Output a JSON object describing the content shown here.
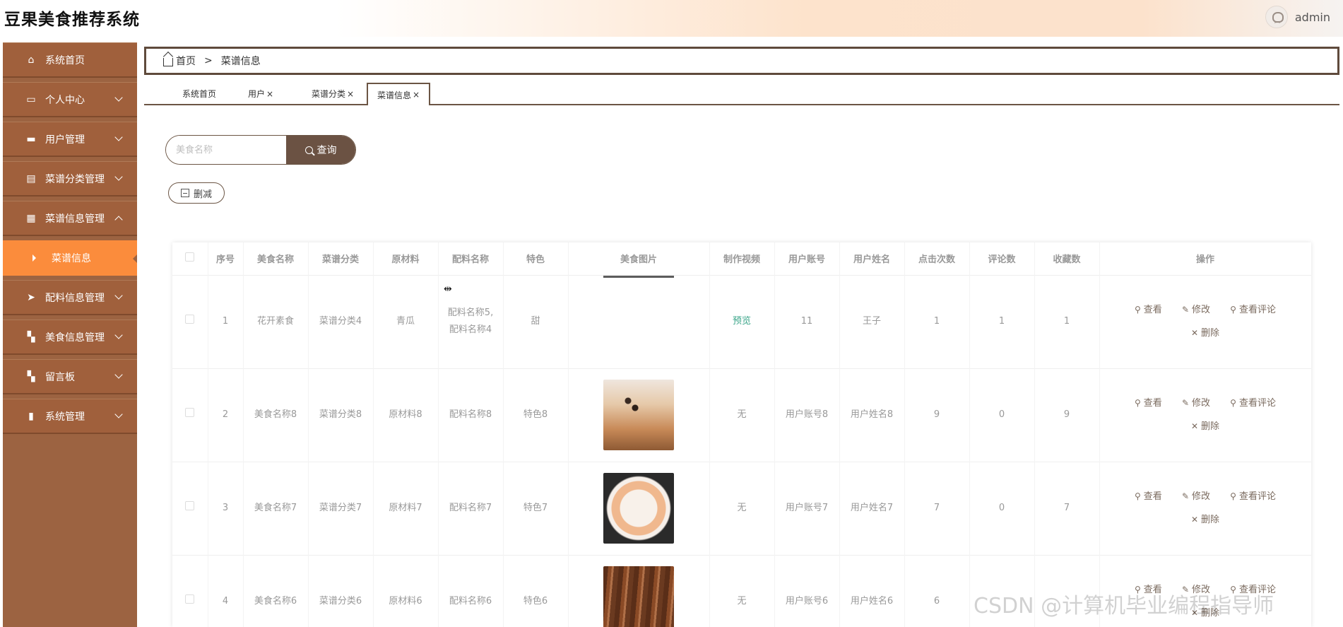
{
  "app": {
    "title": "豆果美食推荐系统",
    "user": "admin"
  },
  "sidebar": {
    "items": [
      {
        "label": "系统首页",
        "icon": "home-icon"
      },
      {
        "label": "个人中心",
        "icon": "card-icon"
      },
      {
        "label": "用户管理",
        "icon": "briefcase-icon"
      },
      {
        "label": "菜谱分类管理",
        "icon": "clipboard-icon"
      },
      {
        "label": "菜谱信息管理",
        "icon": "grid-icon"
      },
      {
        "label": "菜谱信息",
        "icon": "caret-right-icon"
      },
      {
        "label": "配料信息管理",
        "icon": "send-icon"
      },
      {
        "label": "美食信息管理",
        "icon": "apps-icon"
      },
      {
        "label": "留言板",
        "icon": "apps-icon"
      },
      {
        "label": "系统管理",
        "icon": "bar-chart-icon"
      }
    ]
  },
  "breadcrumb": {
    "home": "首页",
    "sep": ">",
    "current": "菜谱信息"
  },
  "tabs": [
    {
      "label": "系统首页",
      "close": ""
    },
    {
      "label": "用户",
      "close": "×"
    },
    {
      "label": "菜谱分类",
      "close": "×"
    },
    {
      "label": "菜谱信息",
      "close": "×"
    }
  ],
  "search": {
    "placeholder": "美食名称",
    "button": "查询"
  },
  "toolbar": {
    "delete_label": "删减"
  },
  "table": {
    "headers": [
      "序号",
      "美食名称",
      "菜谱分类",
      "原材料",
      "配料名称",
      "特色",
      "美食图片",
      "制作视频",
      "用户账号",
      "用户姓名",
      "点击次数",
      "评论数",
      "收藏数",
      "操作"
    ],
    "rows": [
      {
        "idx": "1",
        "name": "花开素食",
        "category": "菜谱分类4",
        "material": "青瓜",
        "ingredient_a": "配料名称5,",
        "ingredient_b": "配料名称4",
        "feature": "甜",
        "video": "预览",
        "account": "11",
        "username": "王子",
        "clicks": "1",
        "comments": "1",
        "favorites": "1"
      },
      {
        "idx": "2",
        "name": "美食名称8",
        "category": "菜谱分类8",
        "material": "原材料8",
        "ingredient_a": "配料名称8",
        "ingredient_b": "",
        "feature": "特色8",
        "video": "无",
        "account": "用户账号8",
        "username": "用户姓名8",
        "clicks": "9",
        "comments": "0",
        "favorites": "9"
      },
      {
        "idx": "3",
        "name": "美食名称7",
        "category": "菜谱分类7",
        "material": "原材料7",
        "ingredient_a": "配料名称7",
        "ingredient_b": "",
        "feature": "特色7",
        "video": "无",
        "account": "用户账号7",
        "username": "用户姓名7",
        "clicks": "7",
        "comments": "0",
        "favorites": "7"
      },
      {
        "idx": "4",
        "name": "美食名称6",
        "category": "菜谱分类6",
        "material": "原材料6",
        "ingredient_a": "配料名称6",
        "ingredient_b": "",
        "feature": "特色6",
        "video": "无",
        "account": "用户账号6",
        "username": "用户姓名6",
        "clicks": "6",
        "comments": "",
        "favorites": ""
      }
    ],
    "actions": {
      "view": "查看",
      "edit": "修改",
      "view_comments": "查看评论",
      "delete": "删除"
    }
  },
  "watermark": "CSDN @计算机毕业编程指导师"
}
